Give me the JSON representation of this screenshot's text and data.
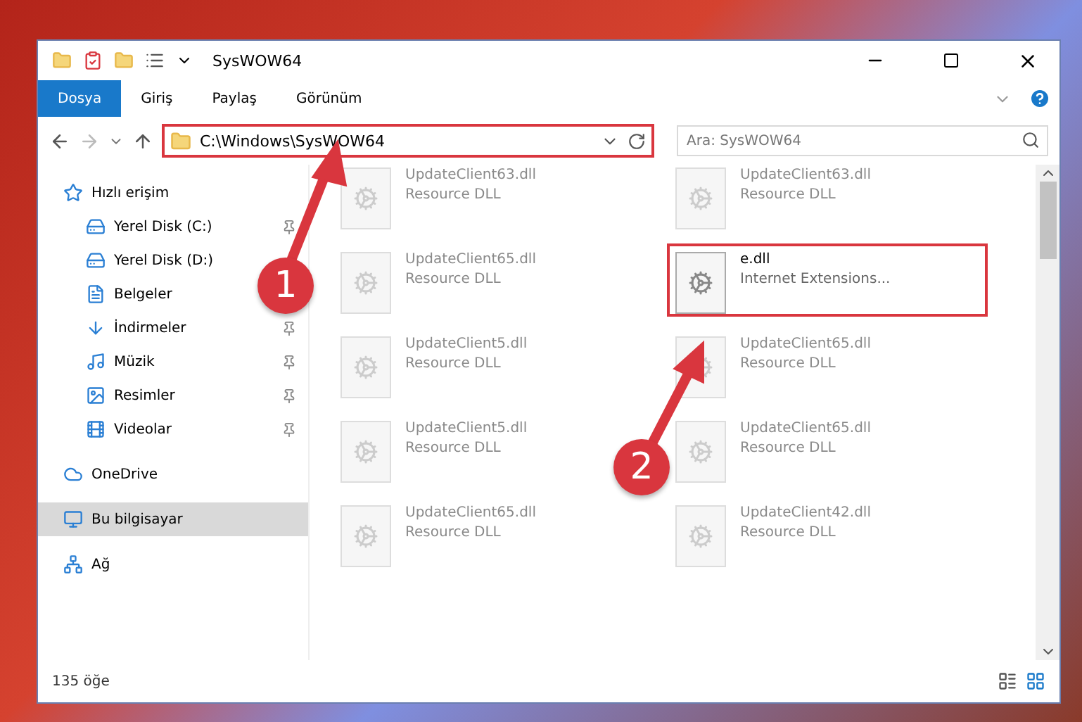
{
  "window": {
    "title": "SysWOW64"
  },
  "ribbon_tabs": [
    {
      "label": "Dosya",
      "selected": true
    },
    {
      "label": "Giriş",
      "selected": false
    },
    {
      "label": "Paylaş",
      "selected": false
    },
    {
      "label": "Görünüm",
      "selected": false
    }
  ],
  "address_bar": {
    "path": "C:\\Windows\\SysWOW64",
    "highlighted": true
  },
  "search": {
    "placeholder": "Ara: SysWOW64"
  },
  "sidebar": {
    "items": [
      {
        "label": "Hızlı erişim",
        "selected": false,
        "children": [
          {
            "label": "Yerel Disk (C:)",
            "pinned": true,
            "selected": false
          },
          {
            "label": "Yerel Disk (D:)",
            "pinned": false,
            "selected": false
          },
          {
            "label": "Belgeler",
            "pinned": false,
            "selected": false
          },
          {
            "label": "İndirmeler",
            "pinned": true,
            "selected": false
          },
          {
            "label": "Müzik",
            "pinned": true,
            "selected": false
          },
          {
            "label": "Resimler",
            "pinned": true,
            "selected": false
          },
          {
            "label": "Videolar",
            "pinned": true,
            "selected": false
          }
        ]
      },
      {
        "label": "OneDrive",
        "selected": false
      },
      {
        "label": "Bu bilgisayar",
        "selected": true
      },
      {
        "label": "Ağ",
        "selected": false
      }
    ]
  },
  "files": [
    {
      "name": "UpdateClient63.dll",
      "type": "Resource DLL",
      "faded": true,
      "highlighted": false
    },
    {
      "name": "UpdateClient63.dll",
      "type": "Resource DLL",
      "faded": true,
      "highlighted": false
    },
    {
      "name": "UpdateClient65.dll",
      "type": "Resource DLL",
      "faded": true,
      "highlighted": false
    },
    {
      "name": "e.dll",
      "type": "Internet Extensions...",
      "faded": false,
      "highlighted": true
    },
    {
      "name": "UpdateClient5.dll",
      "type": "Resource DLL",
      "faded": true,
      "highlighted": false
    },
    {
      "name": "UpdateClient65.dll",
      "type": "Resource DLL",
      "faded": true,
      "highlighted": false
    },
    {
      "name": "UpdateClient5.dll",
      "type": "Resource DLL",
      "faded": true,
      "highlighted": false
    },
    {
      "name": "UpdateClient65.dll",
      "type": "Resource DLL",
      "faded": true,
      "highlighted": false
    },
    {
      "name": "UpdateClient65.dll",
      "type": "Resource DLL",
      "faded": true,
      "highlighted": false
    },
    {
      "name": "UpdateClient42.dll",
      "type": "Resource DLL",
      "faded": true,
      "highlighted": false
    }
  ],
  "status_bar": {
    "count": "135 öğe"
  },
  "callouts": [
    {
      "number": "1"
    },
    {
      "number": "2"
    }
  ]
}
